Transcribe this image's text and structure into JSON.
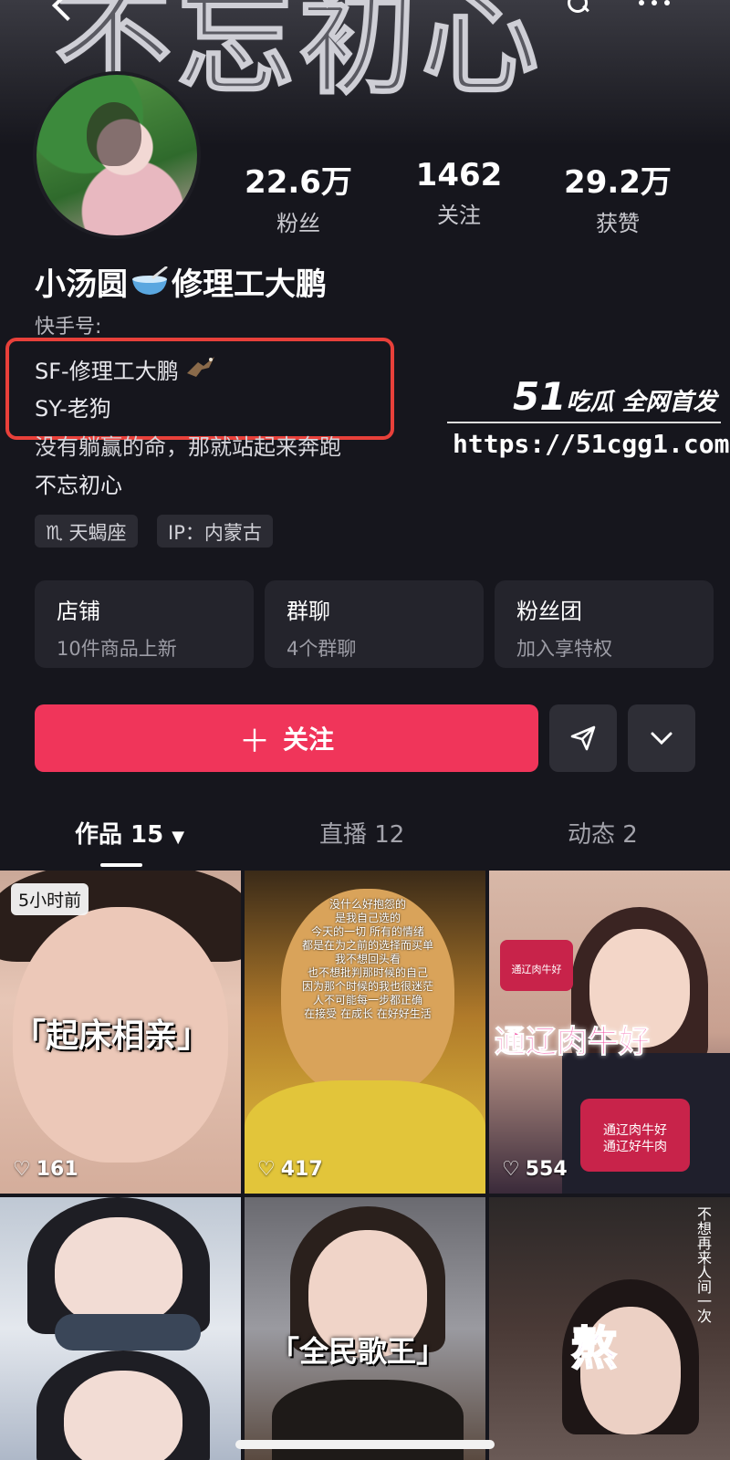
{
  "banner": {
    "text": "不忘初心"
  },
  "stats": [
    {
      "value": "22.6万",
      "label": "粉丝"
    },
    {
      "value": "1462",
      "label": "关注"
    },
    {
      "value": "29.2万",
      "label": "获赞"
    }
  ],
  "profile": {
    "name_part1": "小汤圆",
    "name_part2": "修理工大鹏",
    "kuaishou_label": "快手号:",
    "bio_lines": [
      "SF-修理工大鹏",
      "SY-老狗",
      "没有躺赢的命，那就站起来奔跑",
      "不忘初心"
    ],
    "tags": [
      "天蝎座",
      "IP：内蒙古"
    ]
  },
  "watermark": {
    "logo_num": "51",
    "logo_text": "吃瓜 全网首发",
    "url": "https://51cgg1.com"
  },
  "cards": [
    {
      "title": "店铺",
      "subtitle": "10件商品上新"
    },
    {
      "title": "群聊",
      "subtitle": "4个群聊"
    },
    {
      "title": "粉丝团",
      "subtitle": "加入享特权"
    }
  ],
  "actions": {
    "follow_label": "关注"
  },
  "tabs": [
    {
      "label": "作品 15"
    },
    {
      "label": "直播 12"
    },
    {
      "label": "动态 2"
    }
  ],
  "videos": [
    {
      "badge": "5小时前",
      "caption": "「起床相亲」",
      "likes": "161"
    },
    {
      "overlay_lines": [
        "没什么好抱怨的",
        "是我自己选的",
        "今天的一切 所有的情绪",
        "都是在为之前的选择而买单",
        "我不想回头看",
        "也不想批判那时候的自己",
        "因为那个时候的我也很迷茫",
        "人不可能每一步都正确",
        "在接受 在成长 在好好生活"
      ],
      "likes": "417"
    },
    {
      "caption": "通辽肉牛好",
      "stickers": [
        "通辽肉牛好",
        "通辽肉牛好",
        "通辽好牛肉"
      ],
      "likes": "554"
    },
    {},
    {
      "caption": "「全民歌王」"
    },
    {
      "caption": "熬",
      "vertical_text": "不想再来人间一次"
    }
  ],
  "colors": {
    "accent": "#f0355a",
    "background": "#16161d",
    "highlight_box": "#e8403a"
  }
}
